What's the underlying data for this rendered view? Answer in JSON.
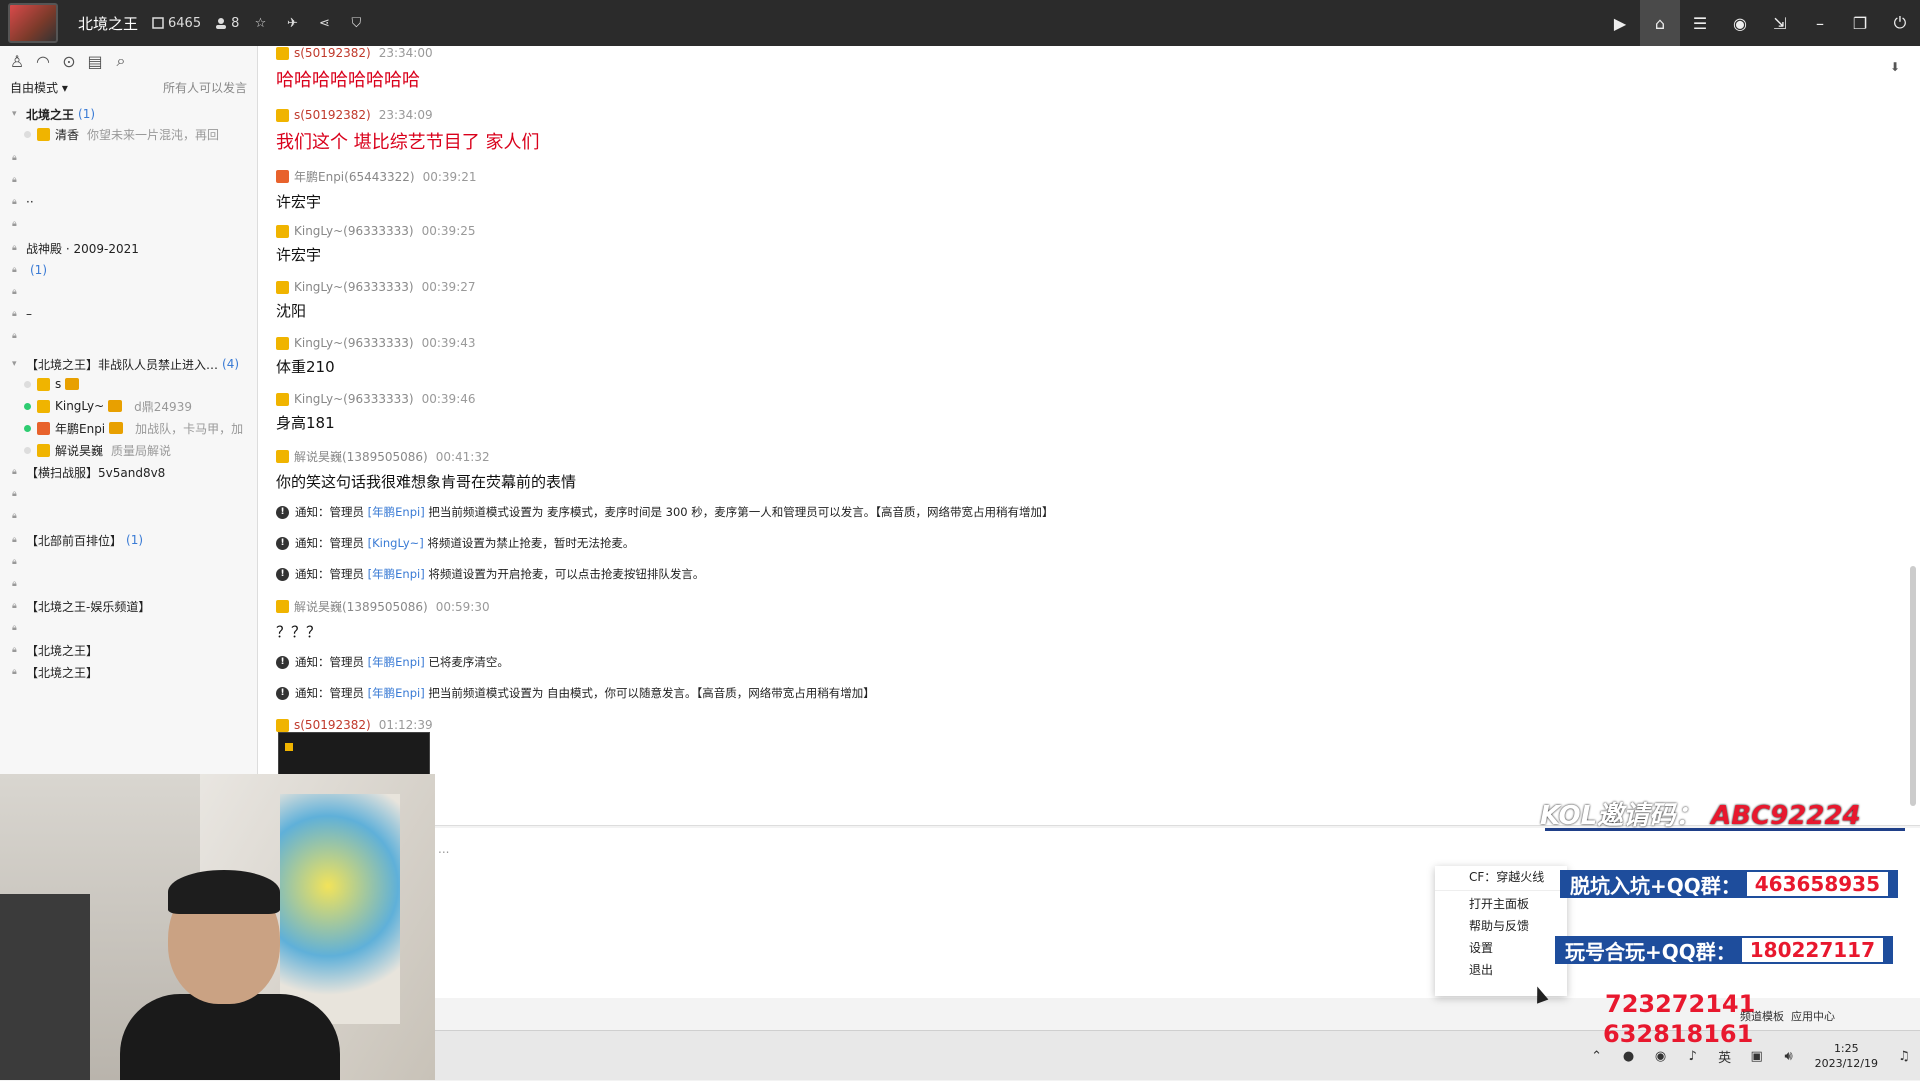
{
  "titlebar": {
    "title": "北境之王",
    "room_id": "6465",
    "online_count": "8"
  },
  "sidebar": {
    "mode_label": "自由模式 ▾",
    "mode_hint": "所有人可以发言",
    "channels": [
      {
        "label": "北境之王",
        "count": "(1)",
        "bold": true
      },
      {
        "label": "清香",
        "hint": "你望未来一片混沌，再回",
        "user": true
      },
      {
        "label": ""
      },
      {
        "label": ""
      },
      {
        "label": "··"
      },
      {
        "label": ""
      },
      {
        "label": "战神殿 · 2009-2021"
      },
      {
        "label": "",
        "count": "(1)"
      },
      {
        "label": ""
      },
      {
        "label": "–"
      },
      {
        "label": ""
      },
      {
        "label": "【北境之王】非战队人员禁止进入…",
        "count": "(4)"
      },
      {
        "label": "s",
        "user": true
      },
      {
        "label": "KingLy~",
        "hint": "d鼎24939",
        "user": true
      },
      {
        "label": "年鹏Enpi",
        "hint": "加战队，卡马甲，加",
        "user": true
      },
      {
        "label": "解说昊巍",
        "hint": "质量局解说",
        "user": true
      },
      {
        "label": "【横扫战服】5v5and8v8"
      },
      {
        "label": ""
      },
      {
        "label": ""
      },
      {
        "label": "【北部前百排位】",
        "count": "(1)"
      },
      {
        "label": ""
      },
      {
        "label": ""
      },
      {
        "label": "【北境之王-娱乐频道】"
      },
      {
        "label": ""
      },
      {
        "label": "【北境之王】"
      },
      {
        "label": "【北境之王】"
      }
    ]
  },
  "chat": {
    "messages": [
      {
        "name": "s(50192382)",
        "time": "23:34:00",
        "text": "哈哈哈哈哈哈哈哈"
      },
      {
        "name": "s(50192382)",
        "time": "23:34:09",
        "text": "我们这个  堪比综艺节目了  家人们"
      },
      {
        "name": "年鹏Enpi(65443322)",
        "time": "00:39:21",
        "text": "许宏宇"
      },
      {
        "name": "KingLy~(96333333)",
        "time": "00:39:25",
        "text": "许宏宇"
      },
      {
        "name": "KingLy~(96333333)",
        "time": "00:39:27",
        "text": "沈阳"
      },
      {
        "name": "KingLy~(96333333)",
        "time": "00:39:43",
        "text": "体重210"
      },
      {
        "name": "KingLy~(96333333)",
        "time": "00:39:46",
        "text": "身高181"
      },
      {
        "name": "解说昊巍(1389505086)",
        "time": "00:41:32",
        "text": "你的笑这句话我很难想象肯哥在荧幕前的表情"
      },
      {
        "name": "解说昊巍(1389505086)",
        "time": "00:59:30",
        "text": "？？？"
      },
      {
        "name": "s(50192382)",
        "time": "01:12:39",
        "text": ""
      }
    ],
    "notices": [
      {
        "pre": "通知：管理员 ",
        "link": "[年鹏Enpi]",
        "post": " 把当前频道模式设置为 麦序模式，麦序时间是 300 秒，麦序第一人和管理员可以发言。【高音质，网络带宽占用稍有增加】"
      },
      {
        "pre": "通知：管理员 ",
        "link": "[KingLy~]",
        "post": " 将频道设置为禁止抢麦，暂时无法抢麦。"
      },
      {
        "pre": "通知：管理员 ",
        "link": "[年鹏Enpi]",
        "post": " 将频道设置为开启抢麦，可以点击抢麦按钮排队发言。"
      },
      {
        "pre": "通知：管理员 ",
        "link": "[年鹏Enpi]",
        "post": " 已将麦序清空。"
      },
      {
        "pre": "通知：管理员 ",
        "link": "[年鹏Enpi]",
        "post": " 把当前频道模式设置为 自由模式，你可以随意发言。【高音质，网络带宽占用稍有增加】"
      }
    ]
  },
  "input": {
    "placeholder": "..."
  },
  "tray_menu": {
    "title": "CF：穿越火线",
    "items": [
      "打开主面板",
      "帮助与反馈",
      "设置",
      "退出"
    ]
  },
  "overlay": {
    "kol_label": "KOL邀请码：",
    "kol_code": "ABC92224",
    "qq1_label": "脱坑入坑+QQ群：",
    "qq1_num": "463658935",
    "qq2_label": "玩号合玩+QQ群：",
    "qq2_num": "180227117",
    "red1": "723272141",
    "red2": "632818161",
    "app_center": "应用中心",
    "channel_template": "频道模板"
  },
  "taskbar": {
    "ime": "英",
    "time": "1:25",
    "date": "2023/12/19"
  }
}
